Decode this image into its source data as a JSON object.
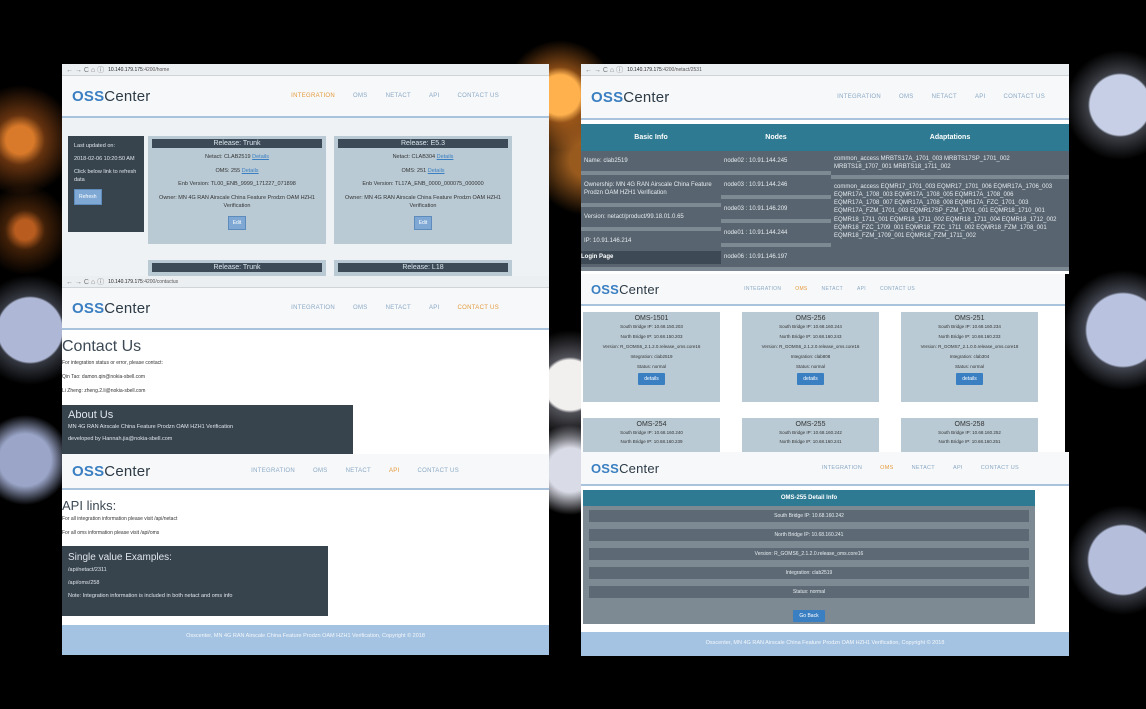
{
  "browser": {
    "nav_icons": "← → C ⌂ ⓘ",
    "home_url_host": "10.140.179.175",
    "home_url_path": ":4200/home",
    "netact_url_host": "10.140.179.175",
    "netact_url_path": ":4200/netact/2531",
    "contact_url_host": "10.140.179.175",
    "contact_url_path": ":4200/contactus"
  },
  "logo": {
    "oss": "OSS",
    "center": "Center"
  },
  "menu": {
    "integration": "INTEGRATION",
    "oms": "OMS",
    "netact": "NETACT",
    "api": "API",
    "contact": "CONTACT US"
  },
  "home": {
    "last_updated_label": "Last updated on:",
    "last_updated_value": "2018-02-06 10:20:50 AM",
    "refresh_hint": "Click below link to refresh data",
    "refresh_button": "Refresh",
    "cards": [
      {
        "title": "Release: Trunk",
        "netact": "Netact: CLAB2519",
        "details": "Details",
        "oms": "OMS: 255",
        "enb": "Enb Version: TL00_ENB_9999_171227_071898",
        "owner": "Owner: MN 4G RAN Airscale China Feature Prodzn OAM HZH1 Verification",
        "edit": "Edit"
      },
      {
        "title": "Release: E5.3",
        "netact": "Netact: CLAB304",
        "details": "Details",
        "oms": "OMS: 251",
        "enb": "Enb Version: TL17A_ENB_0000_000075_000000",
        "owner": "Owner: MN 4G RAN Airscale China Feature Prodzn OAM HZH1 Verification",
        "edit": "Edit"
      }
    ],
    "cards_row2": [
      "Release: Trunk",
      "Release: L18"
    ]
  },
  "netact": {
    "headers": [
      "Basic Info",
      "Nodes",
      "Adaptations"
    ],
    "basic": [
      "Name: clab2519",
      "Ownership: MN 4G RAN Airscale China Feature Prodzn OAM HZH1 Verification",
      "Version: netact/product/99.18.01.0.65",
      "IP: 10.91.146.214"
    ],
    "login": "Login Page",
    "nodes": [
      "node02 : 10.91.144.245",
      "node03 : 10.91.144.246",
      "node03 : 10.91.146.209",
      "node01 : 10.91.144.244",
      "node06 : 10.91.146.197"
    ],
    "adapt1": "common_access MRBTS17A_1701_003 MRBTS17SP_1701_002 MRBTS18_1707_001 MRBTS18_1711_002",
    "adapt2": "common_access EQMR17_1701_003 EQMR17_1701_006 EQMR17A_1706_003 EQMR17A_1708_003 EQMR17A_1708_005 EQMR17A_1708_006 EQMR17A_1708_007 EQMR17A_1708_008 EQMR17A_FZC_1701_003 EQMR17A_FZM_1701_003 EQMR17SP_FZM_1701_001 EQMR18_1710_001 EQMR18_1711_001 EQMR18_1711_002 EQMR18_1711_004 EQMR18_1712_002 EQMR18_FZC_1709_001 EQMR18_FZC_1711_002 EQMR18_FZM_1708_001 EQMR18_FZM_1709_001 EQMR18_FZM_1711_002"
  },
  "oms_list": {
    "cards": [
      {
        "title": "OMS-1501",
        "sb": "South Bridge IP: 10.68.150.203",
        "nb": "North Bridge IP: 10.68.150.203",
        "ver": "Version: R_GOMS6_2.1.2.0.release_oms.core16",
        "integ": "Integration: clab2519",
        "status": "Status: normal",
        "btn": "details"
      },
      {
        "title": "OMS-256",
        "sb": "South Bridge IP: 10.68.160.244",
        "nb": "North Bridge IP: 10.68.160.243",
        "ver": "Version: R_GOMS6_2.1.2.0.release_oms.core16",
        "integ": "Integration: clab808",
        "status": "Status: normal",
        "btn": "details"
      },
      {
        "title": "OMS-251",
        "sb": "South Bridge IP: 10.68.160.234",
        "nb": "North Bridge IP: 10.68.160.233",
        "ver": "Version: R_GOMS7_2.1.0.0.release_oms.core18",
        "integ": "Integration: clab304",
        "status": "Status: normal",
        "btn": "details"
      }
    ],
    "row2": [
      "OMS-254",
      "OMS-255",
      "OMS-258"
    ],
    "row2_sb": [
      "South Bridge IP: 10.68.160.240",
      "South Bridge IP: 10.68.160.242",
      "South Bridge IP: 10.68.160.252"
    ],
    "row2_nb": [
      "North Bridge IP: 10.68.160.239",
      "North Bridge IP: 10.68.160.241",
      "North Bridge IP: 10.68.160.251"
    ]
  },
  "contact": {
    "title": "Contact Us",
    "intro": "For integration status or error, please contact:",
    "person1": "Qin Tao: damon.qin@nokia-sbell.com",
    "person2": "Li Zheng: zheng.2.li@nokia-sbell.com",
    "about_title": "About Us",
    "about_text": "MN 4G RAN Airscale China Feature Prodzn OAM HZH1 Verification",
    "developed": "developed by Hannah.jia@nokia-sbell.com"
  },
  "api": {
    "title": "API links:",
    "line1": "For all integration information please visit /api/netact",
    "line2": "For all oms information please visit /api/oms",
    "examples_title": "Single value Examples:",
    "ex1": "/api/netact/2311",
    "ex2": "/api/oms/258",
    "note": "Note: Integration information is included in both netact and oms info"
  },
  "detail": {
    "title": "OMS-255 Detail Info",
    "rows": [
      "South Bridge IP: 10.68.160.242",
      "North Bridge IP: 10.68.160.241",
      "Version: R_GOMS6_2.1.2.0.release_oms.core16",
      "Integration: clab2519",
      "Status: normal"
    ],
    "back": "Go Back"
  },
  "footer": {
    "text": "Osscenter, MN 4G RAN Airscale China Feature Prodzn OAM HZH1 Verification, Copyright © 2018"
  }
}
